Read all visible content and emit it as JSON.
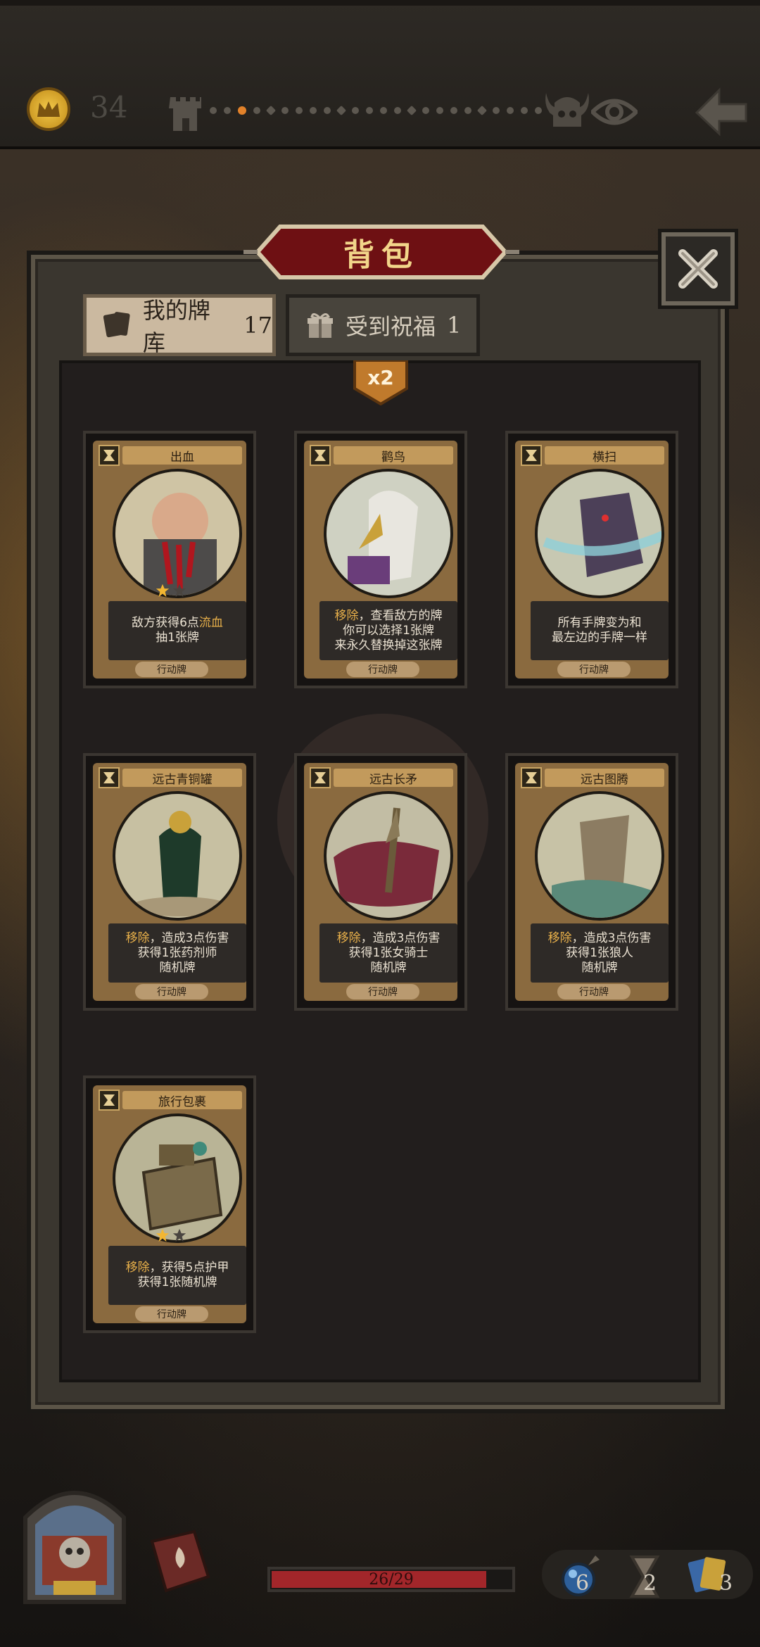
{
  "header": {
    "gold": "34"
  },
  "panel": {
    "title": "背包",
    "tabs": [
      {
        "label": "我的牌库",
        "count": "17",
        "active": true
      },
      {
        "label": "受到祝福",
        "count": "1",
        "active": false
      }
    ],
    "multiplier": "x2"
  },
  "cards": [
    {
      "name": "出血",
      "stars": 1,
      "desc_lines": [
        [
          {
            "t": "敌方获得6点"
          },
          {
            "t": "流血",
            "kw": true
          }
        ],
        [
          {
            "t": "抽1张牌"
          }
        ]
      ],
      "type": "行动牌"
    },
    {
      "name": "鹳鸟",
      "stars": 0,
      "desc_lines": [
        [
          {
            "t": "移除",
            "kw": true
          },
          {
            "t": "，查看敌方的牌"
          }
        ],
        [
          {
            "t": "你可以选择1张牌"
          }
        ],
        [
          {
            "t": "来永久替换掉这张牌"
          }
        ]
      ],
      "type": "行动牌"
    },
    {
      "name": "横扫",
      "stars": 0,
      "desc_lines": [
        [
          {
            "t": "所有手牌变为和"
          }
        ],
        [
          {
            "t": "最左边的手牌一样"
          }
        ]
      ],
      "type": "行动牌"
    },
    {
      "name": "远古青铜罐",
      "stars": 0,
      "desc_lines": [
        [
          {
            "t": "移除",
            "kw": true
          },
          {
            "t": "，造成3点伤害"
          }
        ],
        [
          {
            "t": "获得1张药剂师"
          }
        ],
        [
          {
            "t": "随机牌"
          }
        ]
      ],
      "type": "行动牌"
    },
    {
      "name": "远古长矛",
      "stars": 0,
      "desc_lines": [
        [
          {
            "t": "移除",
            "kw": true
          },
          {
            "t": "，造成3点伤害"
          }
        ],
        [
          {
            "t": "获得1张女骑士"
          }
        ],
        [
          {
            "t": "随机牌"
          }
        ]
      ],
      "type": "行动牌"
    },
    {
      "name": "远古图腾",
      "stars": 0,
      "desc_lines": [
        [
          {
            "t": "移除",
            "kw": true
          },
          {
            "t": "，造成3点伤害"
          }
        ],
        [
          {
            "t": "获得1张狼人"
          }
        ],
        [
          {
            "t": "随机牌"
          }
        ]
      ],
      "type": "行动牌"
    },
    {
      "name": "旅行包裹",
      "stars": 1,
      "desc_lines": [
        [
          {
            "t": "移除",
            "kw": true
          },
          {
            "t": "，获得5点护甲"
          }
        ],
        [
          {
            "t": "获得1张随机牌"
          }
        ]
      ],
      "type": "行动牌"
    }
  ],
  "footer": {
    "hp_text": "26/29",
    "hp_fraction": 0.897,
    "mana": "6",
    "time": "2",
    "cards": "3"
  },
  "colors": {
    "keyword": "#e8b04a",
    "hp": "#a2262a",
    "gold": "#f3c94a"
  }
}
